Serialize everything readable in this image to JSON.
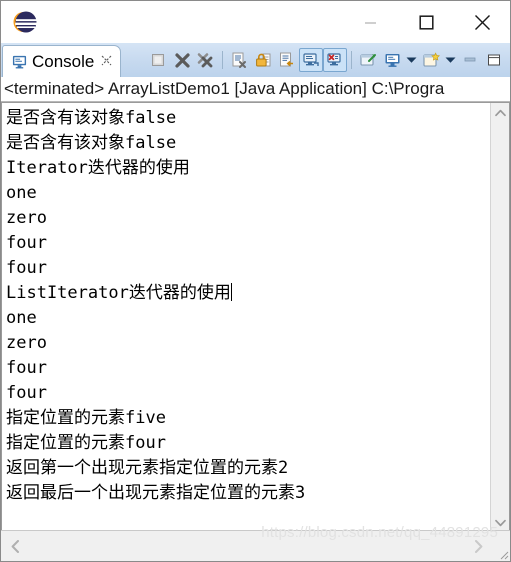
{
  "window": {
    "logo_icon": "eclipse-logo-icon",
    "controls": [
      {
        "name": "minimize",
        "label": "—",
        "icon": "minimize-icon"
      },
      {
        "name": "maximize",
        "label": "☐",
        "icon": "maximize-icon"
      },
      {
        "name": "close",
        "label": "✕",
        "icon": "close-icon"
      }
    ]
  },
  "tab": {
    "label": "Console",
    "icon": "console-view-icon",
    "close_glyph": "☒"
  },
  "toolbar": {
    "buttons": [
      {
        "name": "terminate",
        "icon": "terminate-stop-icon",
        "active": false
      },
      {
        "name": "remove-launch",
        "icon": "remove-launch-x-icon",
        "active": false
      },
      {
        "name": "remove-all-terminated",
        "icon": "remove-all-terminated-xx-icon",
        "active": false
      },
      {
        "name": "clear-console",
        "icon": "clear-console-icon",
        "active": false
      },
      {
        "name": "scroll-lock",
        "icon": "scroll-lock-padlock-icon",
        "active": false
      },
      {
        "name": "word-wrap",
        "icon": "word-wrap-icon",
        "active": false
      },
      {
        "name": "show-console-on-output",
        "icon": "show-console-standard-out-icon",
        "active": true
      },
      {
        "name": "show-console-on-error",
        "icon": "show-console-standard-error-icon",
        "active": true
      },
      {
        "name": "pin-console",
        "icon": "pin-console-icon",
        "active": false
      },
      {
        "name": "display-selected-console",
        "icon": "display-selected-console-icon",
        "active": false
      },
      {
        "name": "display-selected-console-menu",
        "icon": "chevron-down-icon",
        "active": false
      },
      {
        "name": "open-console",
        "icon": "open-console-new-icon",
        "active": false
      },
      {
        "name": "open-console-menu",
        "icon": "chevron-down-icon",
        "active": false
      },
      {
        "name": "minimize-view",
        "icon": "view-minimize-icon",
        "active": false
      },
      {
        "name": "maximize-view",
        "icon": "view-maximize-icon",
        "active": false
      }
    ]
  },
  "launch": {
    "line": "<terminated> ArrayListDemo1 [Java Application] C:\\Progra"
  },
  "console": {
    "lines": [
      "是否含有该对象false",
      "是否含有该对象false",
      "Iterator迭代器的使用",
      "one",
      "zero",
      "four",
      "four",
      "ListIterator迭代器的使用",
      "one",
      "zero",
      "four",
      "four",
      "指定位置的元素five",
      "指定位置的元素four",
      "返回第一个出现元素指定位置的元素2",
      "返回最后一个出现元素指定位置的元素3"
    ],
    "caret_line_index": 7
  },
  "scrollbars": {
    "vertical": {
      "up_icon": "chevron-up-icon",
      "down_icon": "chevron-down-icon"
    },
    "horizontal": {
      "left_icon": "chevron-left-icon",
      "right_icon": "chevron-right-icon"
    }
  },
  "watermark": {
    "text": "https://blog.csdn.net/qq_44891295"
  },
  "colors": {
    "toolbar_bg": "#c6d9ef",
    "active_button_bg": "#cbe2f7",
    "active_button_border": "#7aa7d0",
    "console_bg": "#ffffff",
    "console_text": "#000000",
    "scrollbar_bg": "#f0f0f0",
    "watermark": "#e2e2e2"
  }
}
